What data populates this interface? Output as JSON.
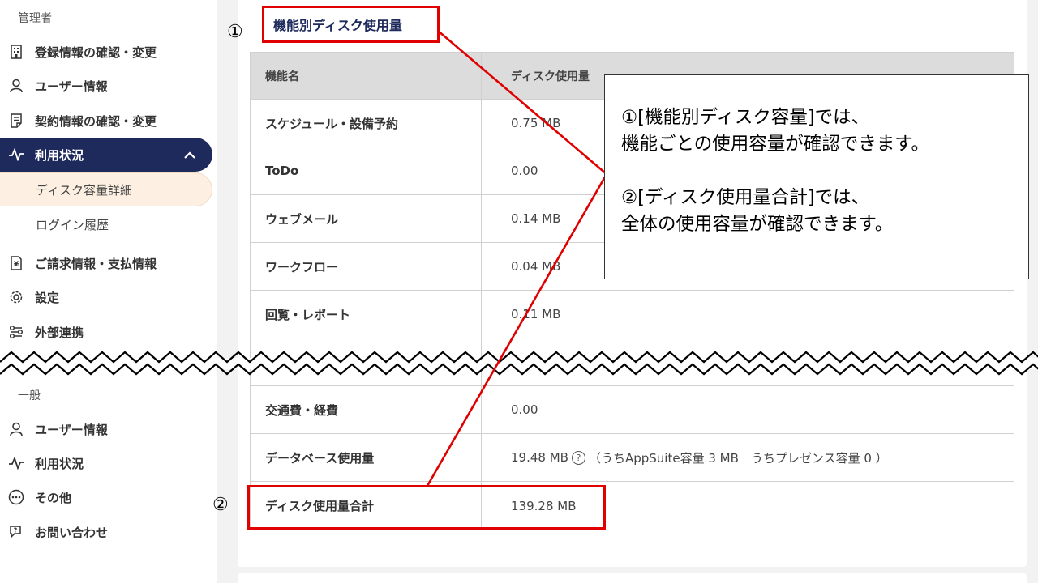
{
  "sidebar": {
    "admin_label": "管理者",
    "admin_items": [
      {
        "label": "登録情報の確認・変更",
        "icon": "building-icon"
      },
      {
        "label": "ユーザー情報",
        "icon": "user-icon"
      },
      {
        "label": "契約情報の確認・変更",
        "icon": "contract-icon"
      }
    ],
    "usage": {
      "label": "利用状況",
      "icon": "activity-icon",
      "chevron": "chevron-up-icon"
    },
    "sub_items": [
      {
        "label": "ディスク容量詳細"
      },
      {
        "label": "ログイン履歴"
      }
    ],
    "admin_items2": [
      {
        "label": "ご請求情報・支払情報",
        "icon": "invoice-icon"
      },
      {
        "label": "設定",
        "icon": "gear-icon"
      },
      {
        "label": "外部連携",
        "icon": "integration-icon"
      }
    ],
    "general_label": "一般",
    "general_items": [
      {
        "label": "ユーザー情報",
        "icon": "user-icon"
      },
      {
        "label": "利用状況",
        "icon": "activity-icon"
      },
      {
        "label": "その他",
        "icon": "more-icon"
      },
      {
        "label": "お問い合わせ",
        "icon": "contact-icon"
      }
    ]
  },
  "main": {
    "section_title": "機能別ディスク使用量",
    "table": {
      "headers": [
        "機能名",
        "ディスク使用量"
      ],
      "rows_top": [
        {
          "name": "スケジュール・設備予約",
          "value": "0.75 MB"
        },
        {
          "name": "ToDo",
          "value": "0.00"
        },
        {
          "name": "ウェブメール",
          "value": "0.14 MB"
        },
        {
          "name": "ワークフロー",
          "value": "0.04 MB"
        },
        {
          "name": "回覧・レポート",
          "value": "0.11 MB"
        }
      ],
      "rows_bottom": [
        {
          "name": "交通費・経費",
          "value": "0.00"
        },
        {
          "name": "データベース使用量",
          "value_main": "19.48 MB",
          "value_note": "（うちAppSuite容量 3 MB　うちプレゼンス容量 0 ）"
        },
        {
          "name": "ディスク使用量合計",
          "value": "139.28 MB"
        }
      ]
    }
  },
  "annotations": {
    "marker1": "①",
    "marker2": "②",
    "callout": {
      "line1": "①[機能別ディスク容量]では、",
      "line2": "機能ごとの使用容量が確認できます。",
      "line3": "②[ディスク使用量合計]では、",
      "line4": "全体の使用容量が確認できます。"
    },
    "colors": {
      "highlight": "#e00000",
      "nav_active": "#1f2a5c",
      "sub_active": "#fdf0e2"
    }
  }
}
